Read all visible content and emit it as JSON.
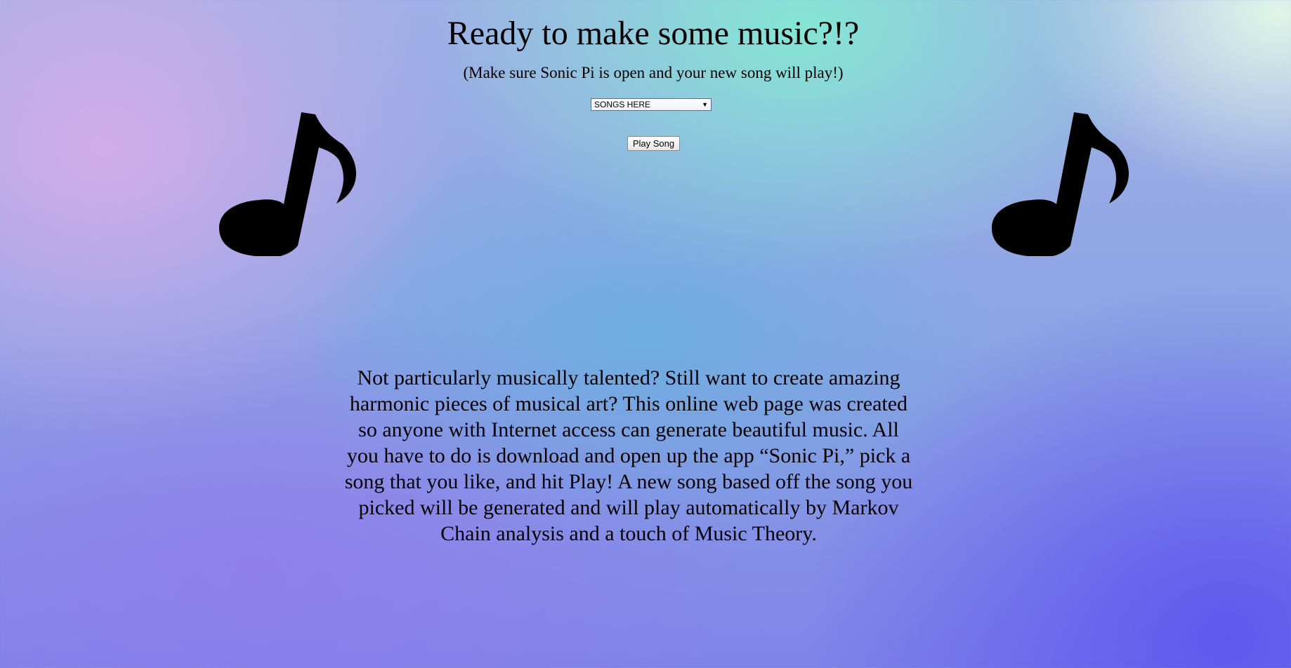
{
  "header": {
    "title": "Ready to make some music?!?",
    "subtitle": "(Make sure Sonic Pi is open and your new song will play!)"
  },
  "controls": {
    "song_select": {
      "selected": "SONGS HERE",
      "caret": "▼"
    },
    "play_button_label": "Play Song"
  },
  "decorations": {
    "left_icon": "music-note-icon",
    "right_icon": "music-note-icon"
  },
  "description": "Not particularly musically talented? Still want to create amazing harmonic pieces of musical art? This online web page was created so anyone with Internet access can generate beautiful music. All you have to do is download and open up the app “Sonic Pi,” pick a song that you like, and hit Play! A new song based off the song you picked will be generated and will play automatically by Markov Chain analysis and a touch of Music Theory.",
  "colors": {
    "text": "#000000",
    "bg_purple": "#5850f0",
    "bg_teal": "#82ecd2",
    "bg_pink": "#deacec"
  }
}
